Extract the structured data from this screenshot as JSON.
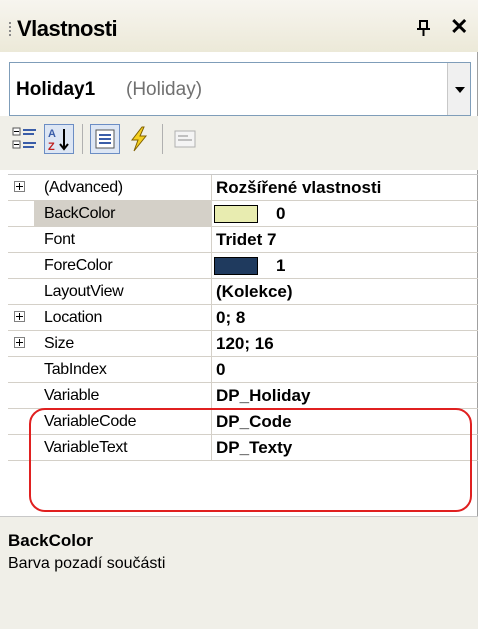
{
  "window": {
    "title": "Vlastnosti",
    "pin_icon": "pin-icon",
    "close_glyph": "✕"
  },
  "object_selector": {
    "name": "Holiday1",
    "type": "(Holiday)"
  },
  "toolbar": {
    "buttons": [
      "categorized-icon",
      "alphabetical-icon",
      "properties-icon",
      "events-icon",
      "property-pages-icon"
    ]
  },
  "properties": [
    {
      "name": "(Advanced)",
      "value": "Rozšířené vlastnosti",
      "expandable": true
    },
    {
      "name": "BackColor",
      "value": "0",
      "swatch": "#e8ecb0",
      "selected": true
    },
    {
      "name": "Font",
      "value": "Tridet 7"
    },
    {
      "name": "ForeColor",
      "value": "1",
      "swatch": "#1f3a5e"
    },
    {
      "name": "LayoutView",
      "value": "(Kolekce)"
    },
    {
      "name": "Location",
      "value": "0; 8",
      "expandable": true
    },
    {
      "name": "Size",
      "value": "120; 16",
      "expandable": true
    },
    {
      "name": "TabIndex",
      "value": "0"
    },
    {
      "name": "Variable",
      "value": "DP_Holiday"
    },
    {
      "name": "VariableCode",
      "value": "DP_Code"
    },
    {
      "name": "VariableText",
      "value": "DP_Texty"
    }
  ],
  "description": {
    "title": "BackColor",
    "text": "Barva pozadí součásti"
  },
  "colors": {
    "highlight_outline": "#e02020",
    "toolbar_bg": "#f0efe8"
  }
}
